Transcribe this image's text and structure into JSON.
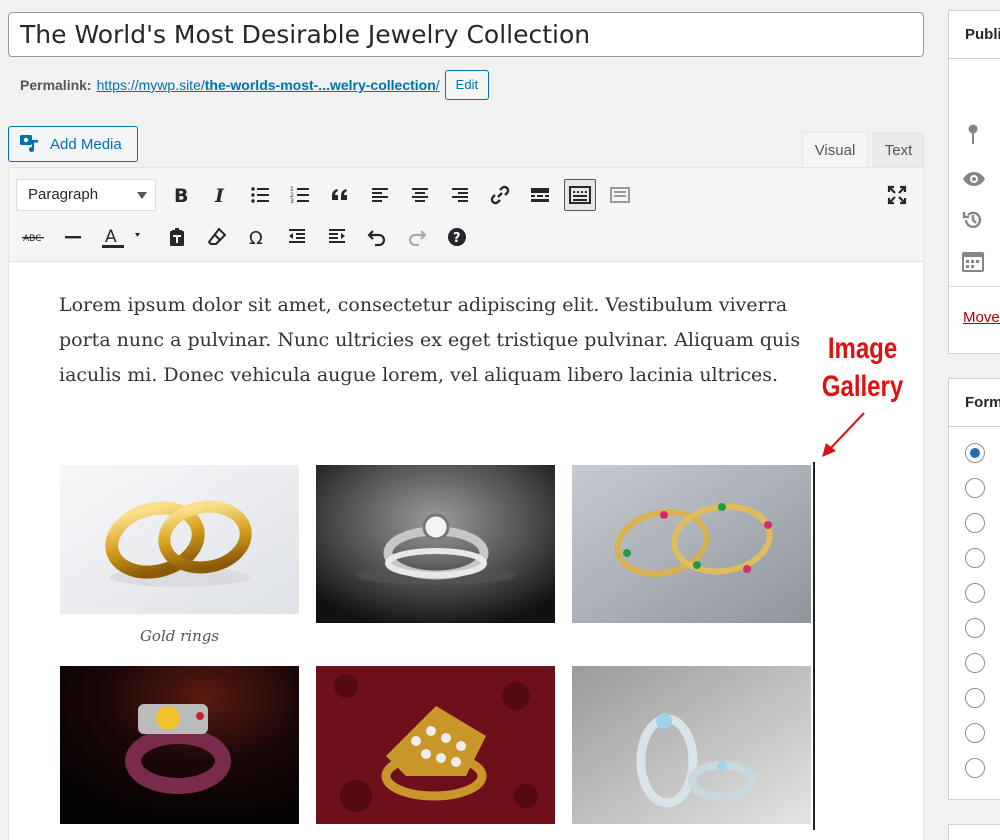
{
  "post": {
    "title": "The World's Most Desirable Jewelry Collection",
    "permalink_label": "Permalink:",
    "permalink_base": "https://mywp.site/",
    "permalink_slug": "the-worlds-most-...welry-collection",
    "permalink_trailing": "/",
    "permalink_edit": "Edit"
  },
  "media": {
    "add_media_label": "Add Media"
  },
  "tabs": {
    "visual": "Visual",
    "text": "Text"
  },
  "toolbar": {
    "format_selected": "Paragraph"
  },
  "content": {
    "paragraph": "Lorem ipsum dolor sit amet, consectetur adipiscing elit. Vestibulum viverra porta nunc a pulvinar. Nunc ultricies ex eget tristique pulvinar. Aliquam quis iaculis mi. Donec vehicula augue lorem, vel aliquam libero lacinia ultrices."
  },
  "gallery": {
    "caption_1": "Gold rings"
  },
  "annotation": {
    "line1": "Image",
    "line2": "Gallery"
  },
  "sidebar": {
    "publish_header": "Publish",
    "format_header": "Format",
    "move_link": "Move to Trash"
  },
  "colors": {
    "accent": "#0073aa",
    "annotation": "#dd1111",
    "trash": "#a00"
  }
}
